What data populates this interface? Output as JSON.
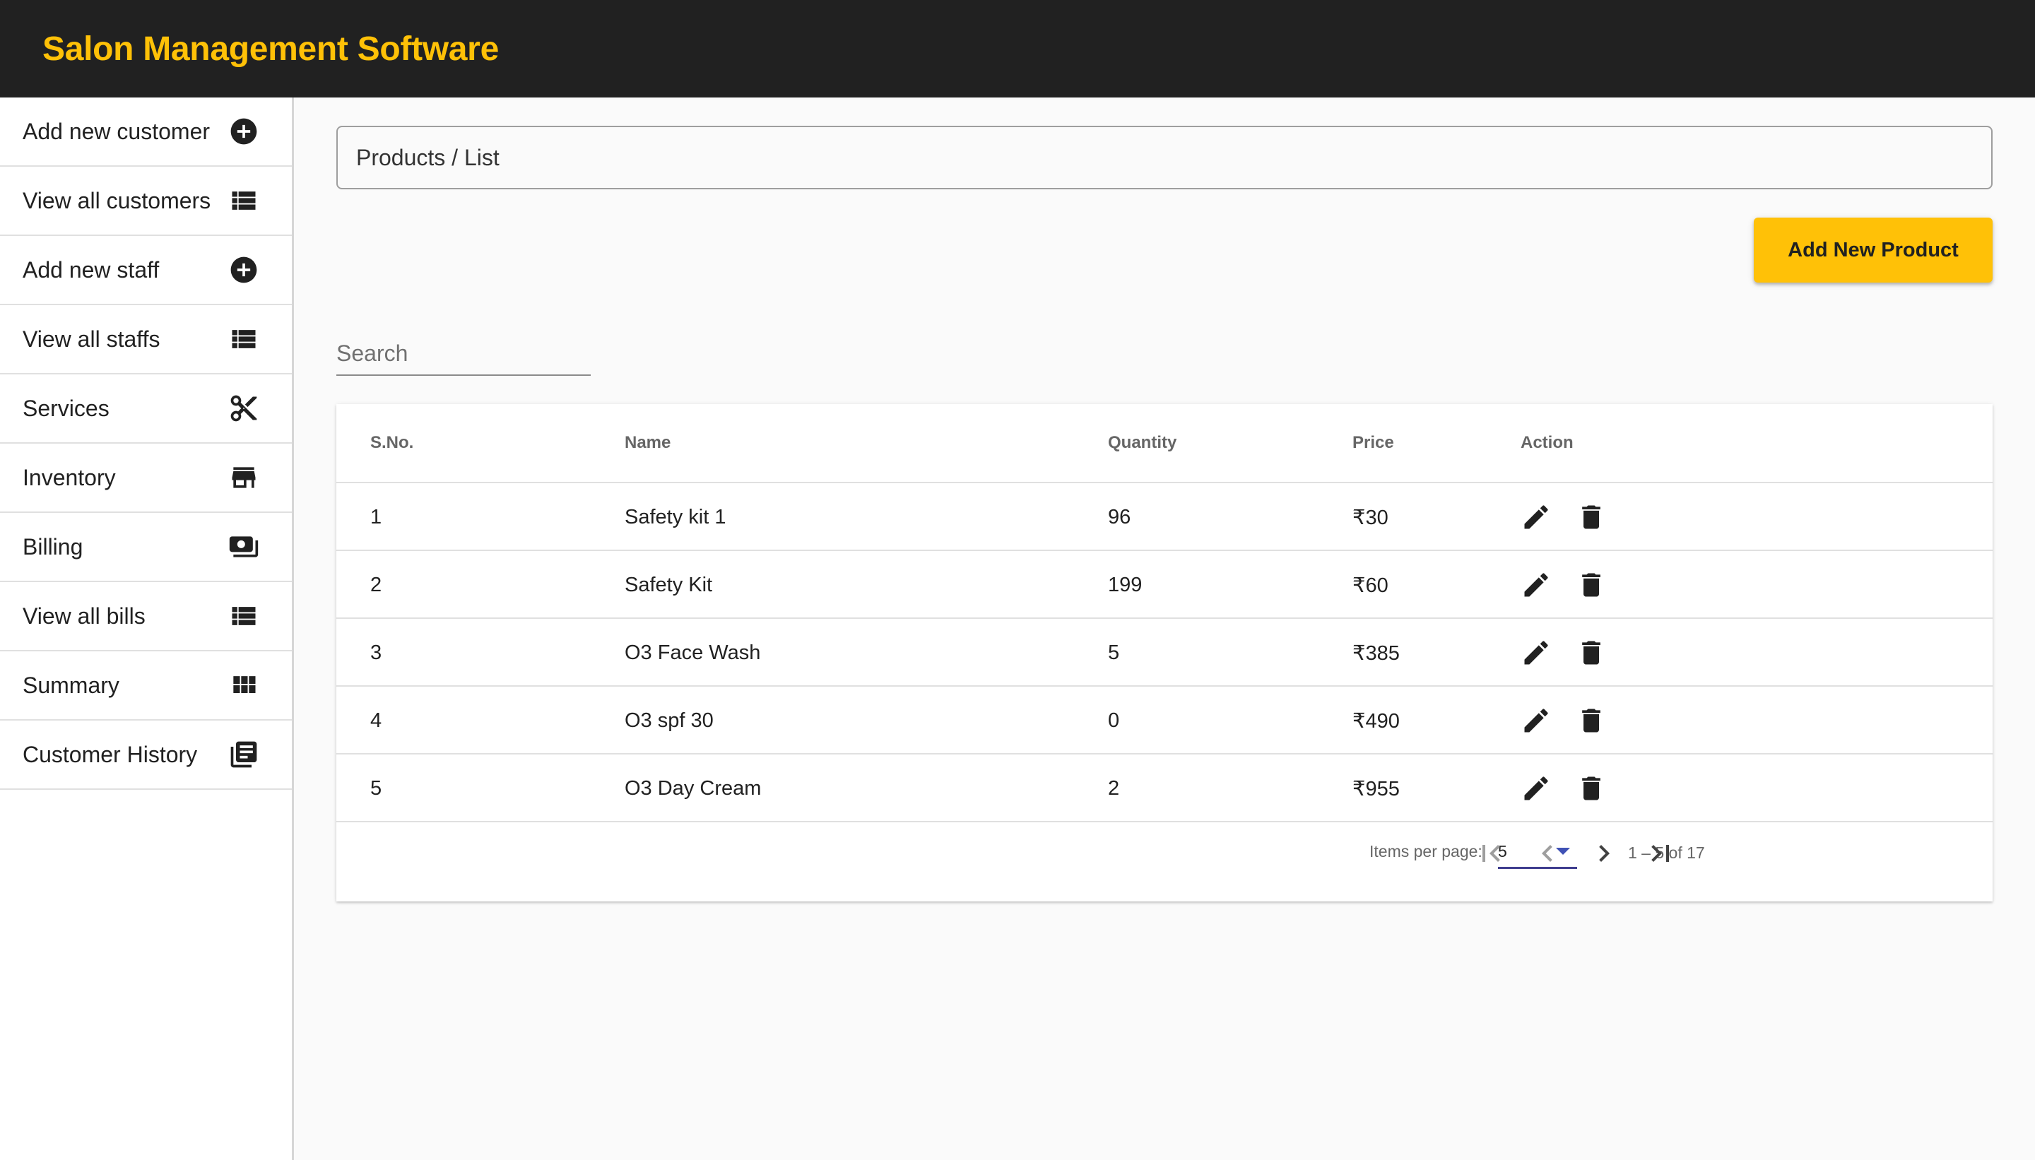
{
  "app": {
    "title": "Salon Management Software"
  },
  "sidebar": {
    "items": [
      {
        "label": "Add new customer",
        "icon": "add-circle-icon"
      },
      {
        "label": "View all customers",
        "icon": "list-icon"
      },
      {
        "label": "Add new staff",
        "icon": "add-circle-icon"
      },
      {
        "label": "View all staffs",
        "icon": "list-icon"
      },
      {
        "label": "Services",
        "icon": "scissors-icon"
      },
      {
        "label": "Inventory",
        "icon": "store-icon"
      },
      {
        "label": "Billing",
        "icon": "money-icon"
      },
      {
        "label": "View all bills",
        "icon": "list-icon"
      },
      {
        "label": "Summary",
        "icon": "grid-icon"
      },
      {
        "label": "Customer History",
        "icon": "article-icon"
      }
    ]
  },
  "main": {
    "breadcrumb": "Products / List",
    "add_button_label": "Add New Product",
    "search_placeholder": "Search"
  },
  "table": {
    "columns": [
      "S.No.",
      "Name",
      "Quantity",
      "Price",
      "Action"
    ],
    "rows": [
      {
        "sno": "1",
        "name": "Safety kit 1",
        "quantity": "96",
        "price": "₹30"
      },
      {
        "sno": "2",
        "name": "Safety Kit",
        "quantity": "199",
        "price": "₹60"
      },
      {
        "sno": "3",
        "name": "O3 Face Wash",
        "quantity": "5",
        "price": "₹385"
      },
      {
        "sno": "4",
        "name": "O3 spf 30",
        "quantity": "0",
        "price": "₹490"
      },
      {
        "sno": "5",
        "name": "O3 Day Cream",
        "quantity": "2",
        "price": "₹955"
      }
    ]
  },
  "paginator": {
    "items_per_page_label": "Items per page:",
    "items_per_page_value": "5",
    "range_label": "1 – 5 of 17"
  },
  "colors": {
    "header_bg": "#212121",
    "brand_accent": "#ffc107",
    "select_underline": "#3f3d8f"
  }
}
